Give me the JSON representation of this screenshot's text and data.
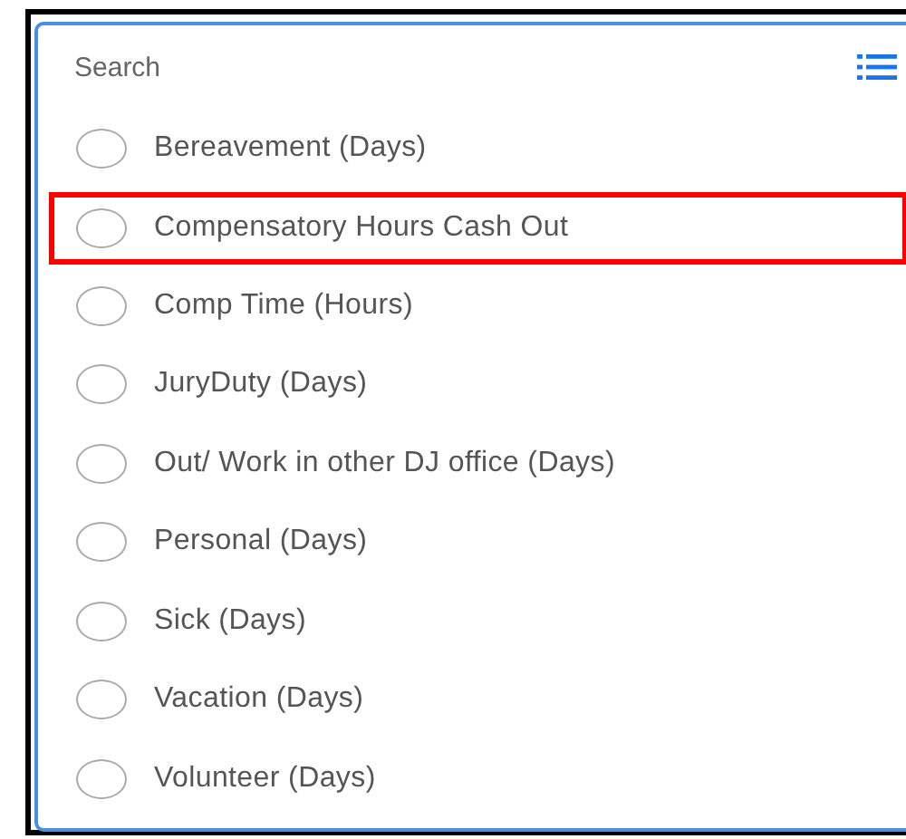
{
  "search": {
    "placeholder": "Search"
  },
  "options": [
    {
      "label": "Bereavement (Days)",
      "selected": false,
      "highlighted": false
    },
    {
      "label": "Compensatory Hours Cash Out",
      "selected": false,
      "highlighted": true
    },
    {
      "label": "Comp Time (Hours)",
      "selected": false,
      "highlighted": false
    },
    {
      "label": "JuryDuty (Days)",
      "selected": false,
      "highlighted": false
    },
    {
      "label": "Out/ Work in other DJ office (Days)",
      "selected": false,
      "highlighted": false
    },
    {
      "label": "Personal (Days)",
      "selected": false,
      "highlighted": false
    },
    {
      "label": "Sick (Days)",
      "selected": false,
      "highlighted": false
    },
    {
      "label": "Vacation (Days)",
      "selected": false,
      "highlighted": false
    },
    {
      "label": "Volunteer (Days)",
      "selected": false,
      "highlighted": false
    }
  ]
}
